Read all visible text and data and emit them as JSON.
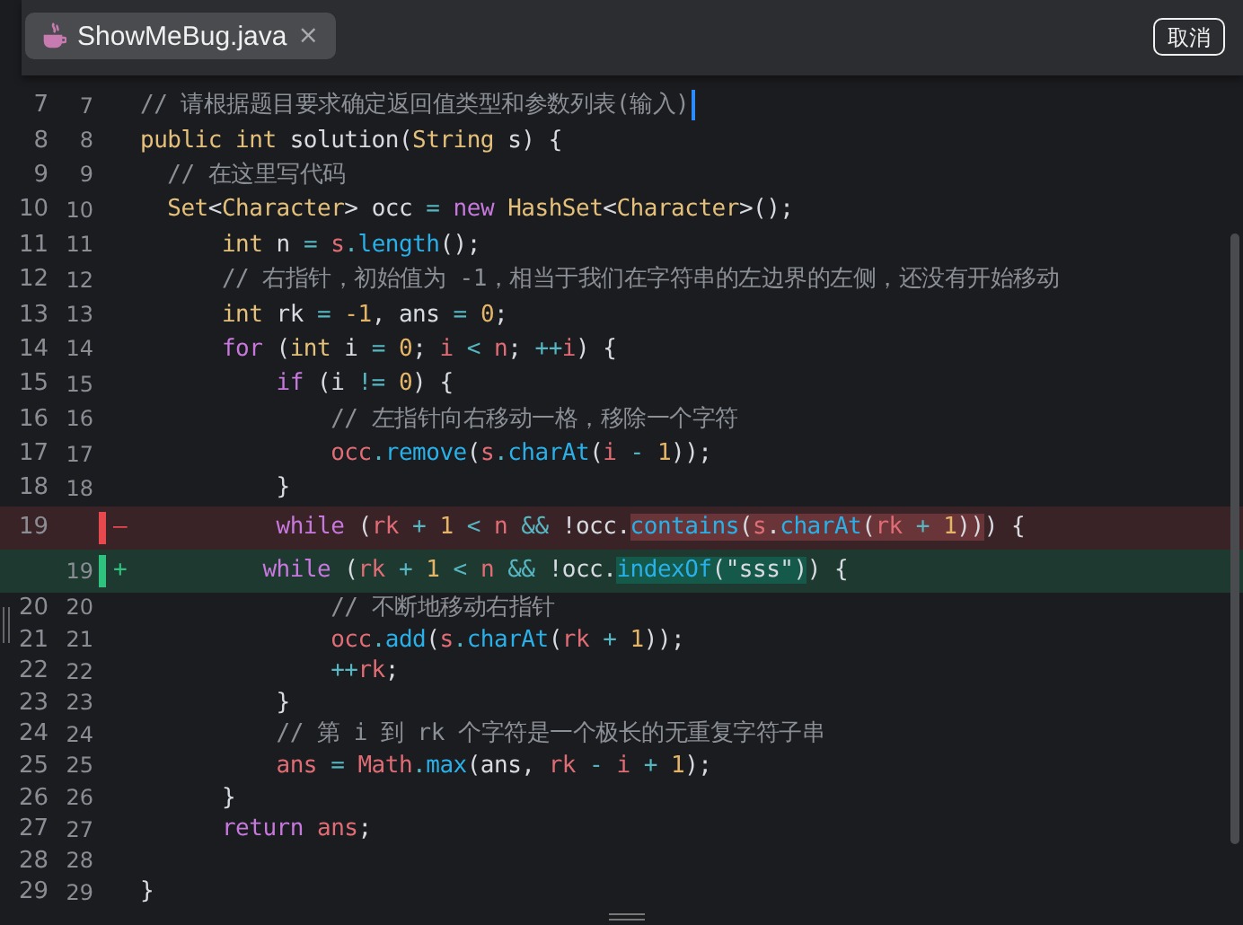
{
  "tab": {
    "title": "ShowMeBug.java",
    "close": "×",
    "selected": true
  },
  "cancel_button": "取消",
  "lines": [
    {
      "kind": "normal",
      "old": "7",
      "new": "7",
      "cursor": true,
      "tokens": [
        {
          "kind": "comment",
          "t": "// 请根据题目要求确定返回值类型和参数列表(输入)"
        }
      ]
    },
    {
      "kind": "normal",
      "old": "8",
      "new": "8",
      "cursor": false,
      "tokens": [
        {
          "kind": "type",
          "t": "public int "
        },
        {
          "kind": "plain",
          "t": "solution("
        },
        {
          "kind": "type",
          "t": "String"
        },
        {
          "kind": "plain",
          "t": " s) {"
        }
      ]
    },
    {
      "kind": "normal",
      "old": "9",
      "new": "9",
      "cursor": false,
      "tokens": [
        {
          "kind": "comment",
          "t": "  // 在这里写代码"
        }
      ]
    },
    {
      "kind": "normal",
      "old": "10",
      "new": "10",
      "cursor": false,
      "tokens": [
        {
          "kind": "type",
          "t": "  Set"
        },
        {
          "kind": "plain",
          "t": "<"
        },
        {
          "kind": "type",
          "t": "Character"
        },
        {
          "kind": "plain",
          "t": "> occ "
        },
        {
          "kind": "op",
          "t": "="
        },
        {
          "kind": "kw",
          "t": " new "
        },
        {
          "kind": "type",
          "t": "HashSet"
        },
        {
          "kind": "plain",
          "t": "<"
        },
        {
          "kind": "type",
          "t": "Character"
        },
        {
          "kind": "plain",
          "t": ">();"
        }
      ]
    },
    {
      "kind": "normal",
      "old": "11",
      "new": "11",
      "cursor": false,
      "tokens": [
        {
          "kind": "type",
          "t": "      int"
        },
        {
          "kind": "plain",
          "t": " n "
        },
        {
          "kind": "op",
          "t": "="
        },
        {
          "kind": "var",
          "t": " s"
        },
        {
          "kind": "op",
          "t": "."
        },
        {
          "kind": "fn",
          "t": "length"
        },
        {
          "kind": "plain",
          "t": "();"
        }
      ]
    },
    {
      "kind": "normal",
      "old": "12",
      "new": "12",
      "cursor": false,
      "tokens": [
        {
          "kind": "comment",
          "t": "      // 右指针，初始值为 -1，相当于我们在字符串的左边界的左侧，还没有开始移动"
        }
      ]
    },
    {
      "kind": "normal",
      "old": "13",
      "new": "13",
      "cursor": false,
      "tokens": [
        {
          "kind": "type",
          "t": "      int"
        },
        {
          "kind": "plain",
          "t": " rk "
        },
        {
          "kind": "op",
          "t": "="
        },
        {
          "kind": "num",
          "t": " -1"
        },
        {
          "kind": "plain",
          "t": ", ans "
        },
        {
          "kind": "op",
          "t": "="
        },
        {
          "kind": "num",
          "t": " 0"
        },
        {
          "kind": "plain",
          "t": ";"
        }
      ]
    },
    {
      "kind": "normal",
      "old": "14",
      "new": "14",
      "cursor": false,
      "tokens": [
        {
          "kind": "kw",
          "t": "      for"
        },
        {
          "kind": "plain",
          "t": " ("
        },
        {
          "kind": "type",
          "t": "int"
        },
        {
          "kind": "plain",
          "t": " i "
        },
        {
          "kind": "op",
          "t": "="
        },
        {
          "kind": "num",
          "t": " 0"
        },
        {
          "kind": "plain",
          "t": "; "
        },
        {
          "kind": "var",
          "t": "i"
        },
        {
          "kind": "op",
          "t": " < "
        },
        {
          "kind": "var",
          "t": "n"
        },
        {
          "kind": "plain",
          "t": "; "
        },
        {
          "kind": "op",
          "t": "++"
        },
        {
          "kind": "var",
          "t": "i"
        },
        {
          "kind": "plain",
          "t": ") {"
        }
      ]
    },
    {
      "kind": "normal",
      "old": "15",
      "new": "15",
      "cursor": false,
      "tokens": [
        {
          "kind": "kw",
          "t": "          if"
        },
        {
          "kind": "plain",
          "t": " (i "
        },
        {
          "kind": "op",
          "t": "!="
        },
        {
          "kind": "num",
          "t": " 0"
        },
        {
          "kind": "plain",
          "t": ") {"
        }
      ]
    },
    {
      "kind": "normal",
      "old": "16",
      "new": "16",
      "cursor": false,
      "tokens": [
        {
          "kind": "comment",
          "t": "              // 左指针向右移动一格，移除一个字符"
        }
      ]
    },
    {
      "kind": "normal",
      "old": "17",
      "new": "17",
      "cursor": false,
      "tokens": [
        {
          "kind": "var",
          "t": "              occ"
        },
        {
          "kind": "op",
          "t": "."
        },
        {
          "kind": "fn",
          "t": "remove"
        },
        {
          "kind": "plain",
          "t": "("
        },
        {
          "kind": "var",
          "t": "s"
        },
        {
          "kind": "op",
          "t": "."
        },
        {
          "kind": "fn",
          "t": "charAt"
        },
        {
          "kind": "plain",
          "t": "("
        },
        {
          "kind": "var",
          "t": "i"
        },
        {
          "kind": "op",
          "t": " - "
        },
        {
          "kind": "num",
          "t": "1"
        },
        {
          "kind": "plain",
          "t": "));"
        }
      ]
    },
    {
      "kind": "normal",
      "old": "18",
      "new": "18",
      "cursor": false,
      "tokens": [
        {
          "kind": "plain",
          "t": "          }"
        }
      ]
    },
    {
      "kind": "removed",
      "old": "19",
      "sign": "–",
      "tokens": [
        {
          "kind": "kw",
          "t": "          while"
        },
        {
          "kind": "plain",
          "t": " ("
        },
        {
          "kind": "var",
          "t": "rk"
        },
        {
          "kind": "op",
          "t": " + "
        },
        {
          "kind": "num",
          "t": "1"
        },
        {
          "kind": "op",
          "t": " < "
        },
        {
          "kind": "var",
          "t": "n"
        },
        {
          "kind": "op",
          "t": " && "
        },
        {
          "kind": "plain",
          "t": "!occ."
        }
      ],
      "changed": [
        {
          "kind": "fn",
          "t": "contains"
        },
        {
          "kind": "plain",
          "t": "("
        },
        {
          "kind": "var",
          "t": "s"
        },
        {
          "kind": "plain",
          "t": "."
        },
        {
          "kind": "fn",
          "t": "charAt"
        },
        {
          "kind": "plain",
          "t": "("
        },
        {
          "kind": "var",
          "t": "rk"
        },
        {
          "kind": "op",
          "t": " + "
        },
        {
          "kind": "num",
          "t": "1"
        },
        {
          "kind": "plain",
          "t": "))"
        }
      ],
      "after": [
        {
          "kind": "plain",
          "t": ") {"
        }
      ]
    },
    {
      "kind": "added",
      "new": "19",
      "sign": "+",
      "tokens": [
        {
          "kind": "kw",
          "t": "         while"
        },
        {
          "kind": "plain",
          "t": " ("
        },
        {
          "kind": "var",
          "t": "rk"
        },
        {
          "kind": "op",
          "t": " + "
        },
        {
          "kind": "num",
          "t": "1"
        },
        {
          "kind": "op",
          "t": " < "
        },
        {
          "kind": "var",
          "t": "n"
        },
        {
          "kind": "op",
          "t": " && "
        },
        {
          "kind": "plain",
          "t": "!occ."
        }
      ],
      "changed": [
        {
          "kind": "fn",
          "t": "indexOf"
        },
        {
          "kind": "plain",
          "t": "(\"sss\")"
        }
      ],
      "after": [
        {
          "kind": "plain",
          "t": ") {"
        }
      ]
    },
    {
      "kind": "normal",
      "old": "20",
      "new": "20",
      "cursor": false,
      "tokens": [
        {
          "kind": "comment",
          "t": "              // 不断地移动右指针"
        }
      ]
    },
    {
      "kind": "normal",
      "old": "21",
      "new": "21",
      "cursor": false,
      "tokens": [
        {
          "kind": "var",
          "t": "              occ"
        },
        {
          "kind": "op",
          "t": "."
        },
        {
          "kind": "fn",
          "t": "add"
        },
        {
          "kind": "plain",
          "t": "("
        },
        {
          "kind": "var",
          "t": "s"
        },
        {
          "kind": "op",
          "t": "."
        },
        {
          "kind": "fn",
          "t": "charAt"
        },
        {
          "kind": "plain",
          "t": "("
        },
        {
          "kind": "var",
          "t": "rk"
        },
        {
          "kind": "op",
          "t": " + "
        },
        {
          "kind": "num",
          "t": "1"
        },
        {
          "kind": "plain",
          "t": "));"
        }
      ]
    },
    {
      "kind": "normal",
      "old": "22",
      "new": "22",
      "cursor": false,
      "tokens": [
        {
          "kind": "op",
          "t": "              ++"
        },
        {
          "kind": "var",
          "t": "rk"
        },
        {
          "kind": "plain",
          "t": ";"
        }
      ]
    },
    {
      "kind": "normal",
      "old": "23",
      "new": "23",
      "cursor": false,
      "tokens": [
        {
          "kind": "plain",
          "t": "          }"
        }
      ]
    },
    {
      "kind": "normal",
      "old": "24",
      "new": "24",
      "cursor": false,
      "tokens": [
        {
          "kind": "comment",
          "t": "          // 第 i 到 rk 个字符是一个极长的无重复字符子串"
        }
      ]
    },
    {
      "kind": "normal",
      "old": "25",
      "new": "25",
      "cursor": false,
      "tokens": [
        {
          "kind": "var",
          "t": "          ans"
        },
        {
          "kind": "op",
          "t": " = "
        },
        {
          "kind": "var",
          "t": "Math"
        },
        {
          "kind": "op",
          "t": "."
        },
        {
          "kind": "fn",
          "t": "max"
        },
        {
          "kind": "plain",
          "t": "(ans, "
        },
        {
          "kind": "var",
          "t": "rk"
        },
        {
          "kind": "op",
          "t": " - "
        },
        {
          "kind": "var",
          "t": "i"
        },
        {
          "kind": "op",
          "t": " + "
        },
        {
          "kind": "num",
          "t": "1"
        },
        {
          "kind": "plain",
          "t": ");"
        }
      ]
    },
    {
      "kind": "normal",
      "old": "26",
      "new": "26",
      "cursor": false,
      "tokens": [
        {
          "kind": "plain",
          "t": "      }"
        }
      ]
    },
    {
      "kind": "normal",
      "old": "27",
      "new": "27",
      "cursor": false,
      "tokens": [
        {
          "kind": "kw",
          "t": "      return"
        },
        {
          "kind": "var",
          "t": " ans"
        },
        {
          "kind": "plain",
          "t": ";"
        }
      ]
    },
    {
      "kind": "normal",
      "old": "28",
      "new": "28",
      "cursor": false
    },
    {
      "kind": "normal",
      "old": "29",
      "new": "29",
      "cursor": false,
      "tokens": [
        {
          "kind": "plain",
          "t": "}"
        }
      ]
    }
  ]
}
